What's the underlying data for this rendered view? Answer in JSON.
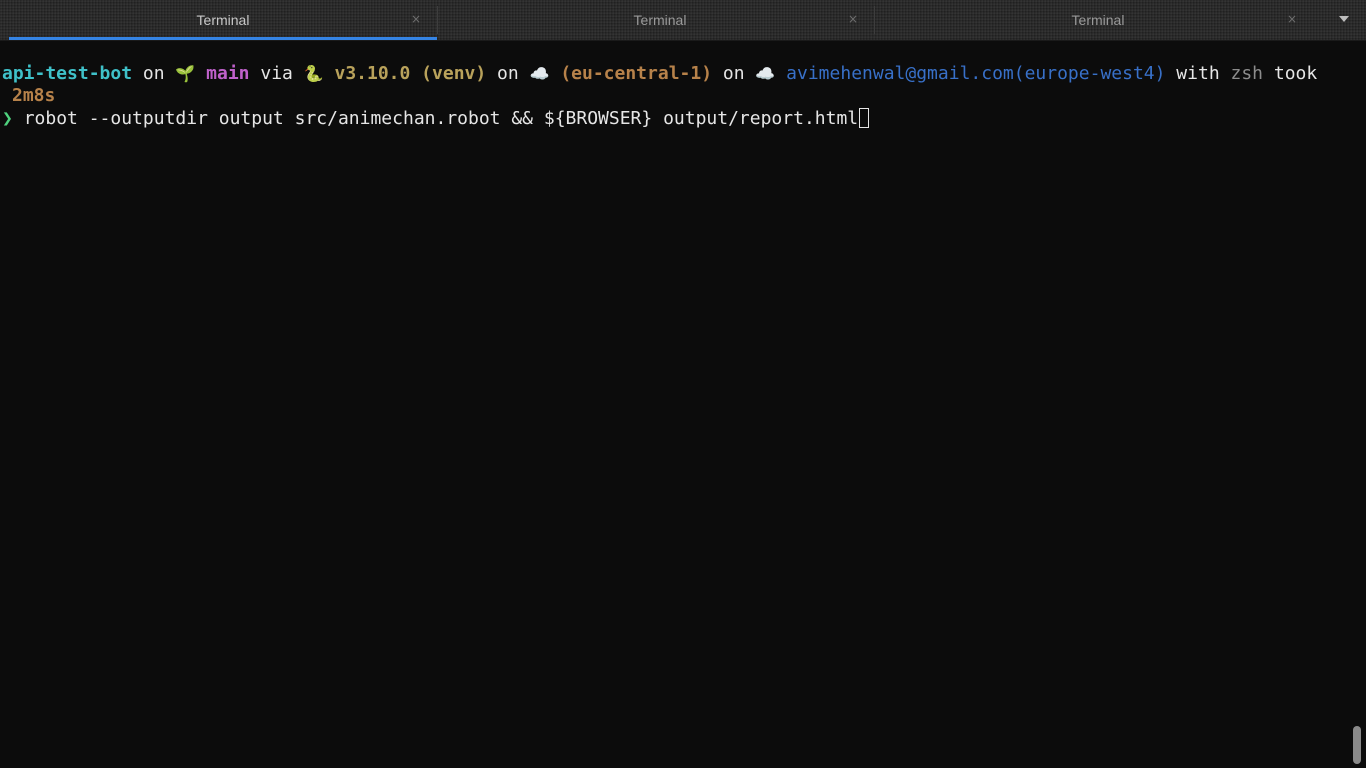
{
  "tabs": [
    {
      "label": "Terminal",
      "active": true
    },
    {
      "label": "Terminal",
      "active": false
    },
    {
      "label": "Terminal",
      "active": false
    }
  ],
  "tab_close_glyph": "×",
  "prompt": {
    "dir": "api-test-bot",
    "on1": " on ",
    "git_icon": "🌱",
    "branch": "main",
    "via": " via ",
    "python_icon": "🐍",
    "python_version": "v3.10.0 (venv)",
    "on2": " on ",
    "aws_icon": "☁️",
    "aws_region": "(eu-central-1)",
    "on3": " on ",
    "gcp_icon": "☁️",
    "gcp_account": "avimehenwal@gmail.com(europe-west4)",
    "with": " with ",
    "shell": "zsh",
    "took": " took",
    "duration": "2m8s",
    "prompt_char": "❯",
    "command": "robot --outputdir output src/animechan.robot && ${BROWSER} output/report.html"
  },
  "colors": {
    "accent": "#3584e4",
    "dir": "#3fc1c9",
    "git_branch": "#c061cb",
    "python": "#b9a25b",
    "aws": "#b7824a",
    "gcp": "#3870c8",
    "prompt_char": "#4fd27e"
  }
}
